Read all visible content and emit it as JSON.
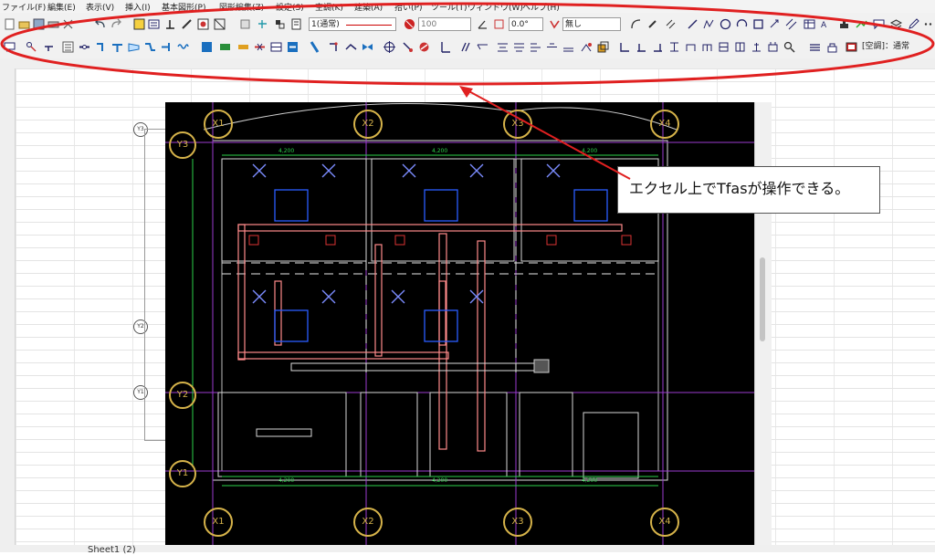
{
  "menu": [
    "ファイル(F)",
    "編集(E)",
    "表示(V)",
    "挿入(I)",
    "基本図形(P)",
    "図形編集(Z)",
    "設定(S)",
    "空調(K)",
    "建築(A)",
    "拾い(P)",
    "ツール(T)",
    "ウィンドウ(W)",
    "ヘルプ(H)"
  ],
  "toolbar": {
    "layer_combo": "1(通常)",
    "pen_value": "100",
    "angle_value": "0.0°",
    "fill_value": "無し",
    "mode_combo": "[空調]：通常"
  },
  "drawing": {
    "grid_x": [
      "X1",
      "X2",
      "X3",
      "X4"
    ],
    "grid_y": [
      "Y3",
      "Y2",
      "Y1"
    ],
    "side_markers": [
      "Y3",
      "Y2",
      "Y1"
    ],
    "dims_top": [
      "4,200",
      "4,200",
      "4,200"
    ],
    "dims_bottom": [
      "4,200",
      "4,200",
      "4,200"
    ]
  },
  "callout": {
    "text": "エクセル上でTfasが操作できる。"
  },
  "annotation_color": "#e02020",
  "sheet_tab": "Sheet1 (2)"
}
